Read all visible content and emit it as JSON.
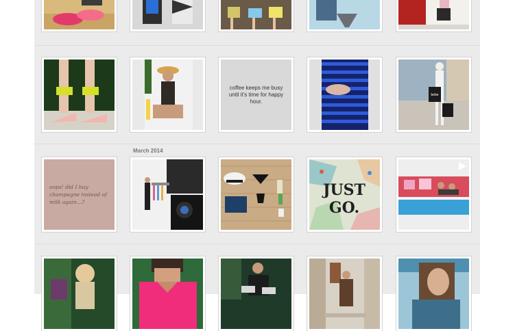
{
  "section_label": "March 2014",
  "quote_tile_text": "coffee keeps me busy until it's time for happy hour.",
  "pink_tile_text": "oops! did I buy champagne instead of milk again...?",
  "poster_tile_text": "JUST GO.",
  "shopping_bag_text": "bebe",
  "icons": {
    "video": "play-icon"
  },
  "colors": {
    "feed_background": "#ebebeb",
    "tile_border": "#d2d2d2",
    "date_label": "#777777"
  }
}
